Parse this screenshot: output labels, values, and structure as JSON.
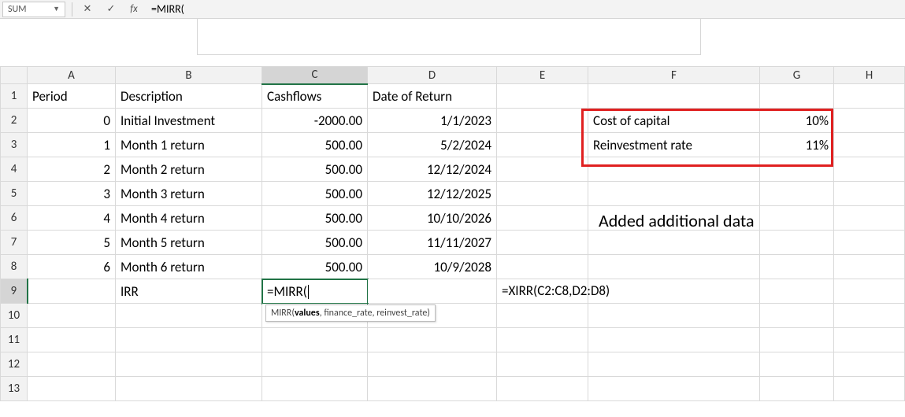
{
  "namebox": "SUM",
  "formula_bar": "=MIRR(",
  "editing_cell": "=MIRR(",
  "tooltip_fn": "MIRR",
  "tooltip_arg_bold": "values",
  "tooltip_args_rest": ", finance_rate, reinvest_rate)",
  "columns": [
    "A",
    "B",
    "C",
    "D",
    "E",
    "F",
    "G",
    "H"
  ],
  "headers": {
    "a": "Period",
    "b": "Description",
    "c": "Cashflows",
    "d": "Date of Return"
  },
  "rows": [
    {
      "period": "0",
      "desc": "Initial Investment",
      "cash": "-2000.00",
      "date": "1/1/2023"
    },
    {
      "period": "1",
      "desc": "Month 1 return",
      "cash": "500.00",
      "date": "5/2/2024"
    },
    {
      "period": "2",
      "desc": "Month 2 return",
      "cash": "500.00",
      "date": "12/12/2024"
    },
    {
      "period": "3",
      "desc": "Month 3 return",
      "cash": "500.00",
      "date": "12/12/2025"
    },
    {
      "period": "4",
      "desc": "Month 4 return",
      "cash": "500.00",
      "date": "10/10/2026"
    },
    {
      "period": "5",
      "desc": "Month 5 return",
      "cash": "500.00",
      "date": "11/11/2027"
    },
    {
      "period": "6",
      "desc": "Month 6 return",
      "cash": "500.00",
      "date": "10/9/2028"
    }
  ],
  "row9_b": "IRR",
  "row9_e_overflow": "=XIRR(C2:C8,D2:D8)",
  "side": {
    "coc_label": "Cost of capital",
    "coc_val": "10%",
    "reinv_label": "Reinvestment rate",
    "reinv_val": "11%"
  },
  "annotation": "Added additional data",
  "row_nums": [
    "1",
    "2",
    "3",
    "4",
    "5",
    "6",
    "7",
    "8",
    "9",
    "10",
    "11",
    "12",
    "13"
  ]
}
